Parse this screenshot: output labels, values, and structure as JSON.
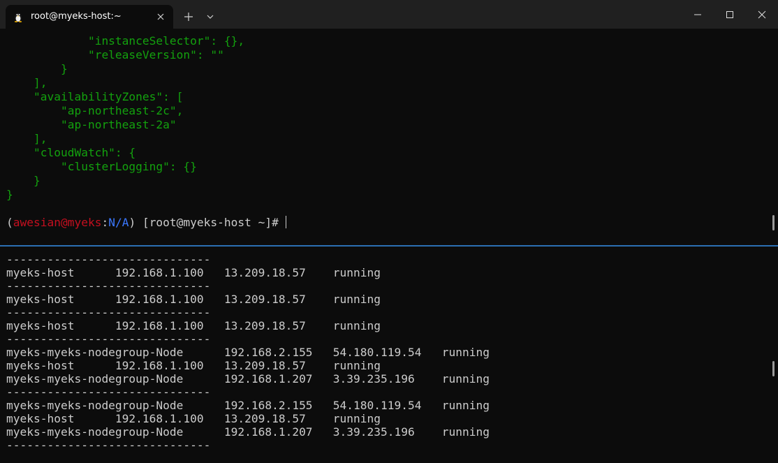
{
  "window": {
    "tab_title": "root@myeks-host:~",
    "tab_icon": "linux-penguin-icon",
    "new_tab_symbol": "+",
    "accent_color": "#2b6fb3"
  },
  "top_pane": {
    "json_lines": [
      "            \"instanceSelector\": {},",
      "            \"releaseVersion\": \"\"",
      "        }",
      "    ],",
      "    \"availabilityZones\": [",
      "        \"ap-northeast-2c\",",
      "        \"ap-northeast-2a\"",
      "    ],",
      "    \"cloudWatch\": {",
      "        \"clusterLogging\": {}",
      "    }",
      "}"
    ],
    "prompt": {
      "open_paren": "(",
      "user_context": "awesian@myeks",
      "colon": ":",
      "namespace": "N/A",
      "rest": ") [root@myeks-host ~]# "
    }
  },
  "bottom_pane": {
    "lines": [
      "------------------------------",
      "myeks-host      192.168.1.100   13.209.18.57    running",
      "------------------------------",
      "myeks-host      192.168.1.100   13.209.18.57    running",
      "------------------------------",
      "myeks-host      192.168.1.100   13.209.18.57    running",
      "------------------------------",
      "myeks-myeks-nodegroup-Node      192.168.2.155   54.180.119.54   running",
      "myeks-host      192.168.1.100   13.209.18.57    running",
      "myeks-myeks-nodegroup-Node      192.168.1.207   3.39.235.196    running",
      "------------------------------",
      "myeks-myeks-nodegroup-Node      192.168.2.155   54.180.119.54   running",
      "myeks-host      192.168.1.100   13.209.18.57    running",
      "myeks-myeks-nodegroup-Node      192.168.1.207   3.39.235.196    running",
      "------------------------------"
    ]
  }
}
